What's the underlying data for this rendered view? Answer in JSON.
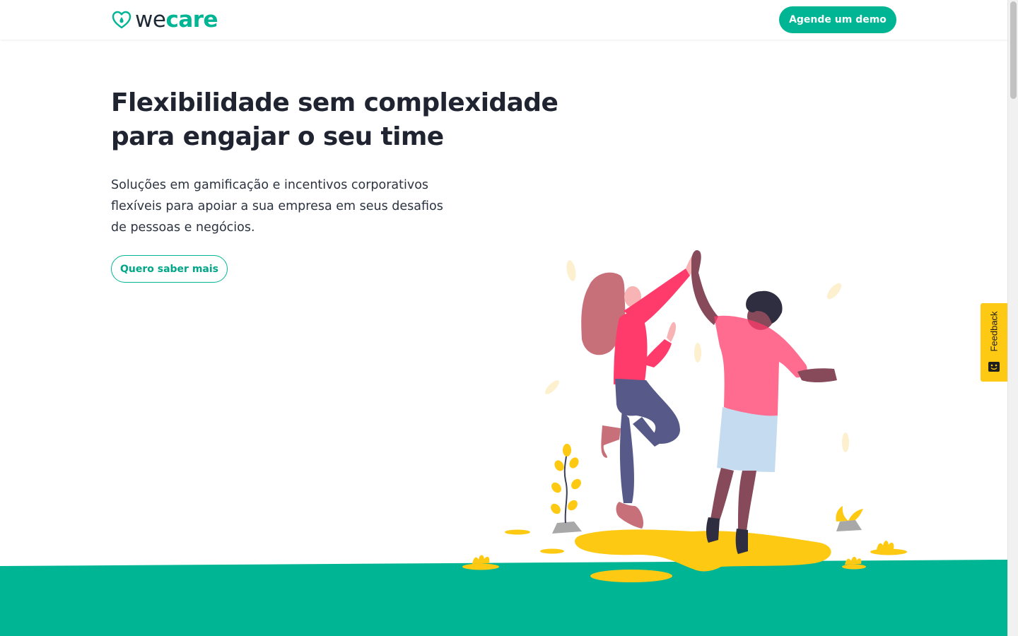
{
  "header": {
    "logo_we": "we",
    "logo_care": "care",
    "demo_button": "Agende um demo"
  },
  "hero": {
    "title_line1": "Flexibilidade sem complexidade",
    "title_line2": "para engajar o seu time",
    "subtitle_line1": "Soluções em gamificação e incentivos corporativos",
    "subtitle_line2": "flexíveis para apoiar a sua empresa em seus desafios",
    "subtitle_line3": "de pessoas e negócios.",
    "cta_button": "Quero saber mais"
  },
  "feedback": {
    "label": "Feedback"
  },
  "colors": {
    "brand_green": "#00b593",
    "text_dark": "#1f2430",
    "accent_yellow": "#fdc913"
  },
  "icons": {
    "logo": "heart-drop-icon",
    "feedback": "smiley-box-icon"
  }
}
